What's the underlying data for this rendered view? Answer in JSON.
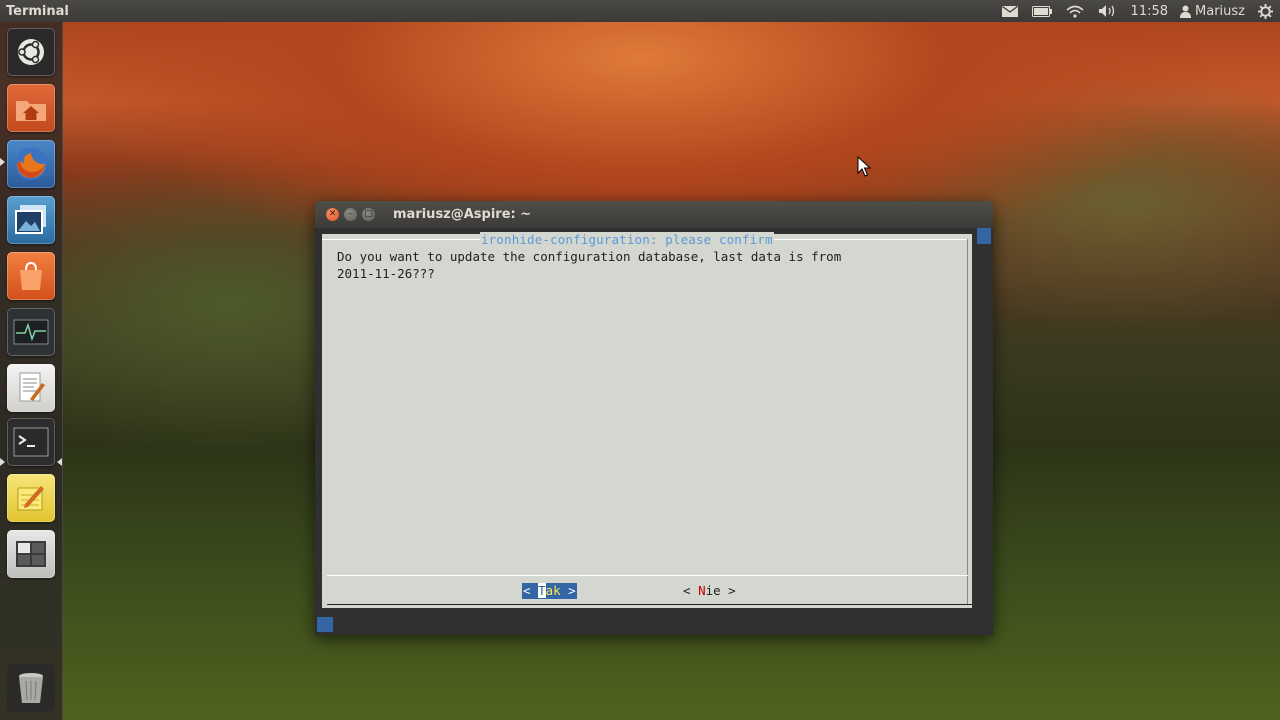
{
  "panel": {
    "app_title": "Terminal",
    "clock": "11:58",
    "user": "Mariusz",
    "icons": [
      "mail-icon",
      "battery-icon",
      "wifi-icon",
      "volume-icon",
      "user-icon",
      "gear-icon"
    ]
  },
  "launcher": {
    "items": [
      "dash-home",
      "home-folder",
      "firefox",
      "shotwell",
      "software-center",
      "system-monitor",
      "gedit",
      "terminal",
      "tomboy-notes",
      "workspace-switcher",
      "trash"
    ]
  },
  "window": {
    "title": "mariusz@Aspire: ~"
  },
  "dialog": {
    "title": "ironhide-configuration: please confirm",
    "message": "Do you want to update the configuration database, last data is from\n2011-11-26???",
    "yes": {
      "open": "< ",
      "hot": "T",
      "rest": "ak",
      "close": " >"
    },
    "no": {
      "open": "< ",
      "hot": "N",
      "rest": "ie",
      "close": " >"
    }
  },
  "colors": {
    "dialog_bg": "#d3d7cf",
    "dialog_title": "#5c9ad6",
    "button_selected": "#3465a4",
    "hotkey_no": "#cc0000",
    "hotkey_yes_rest": "#fce94f"
  }
}
